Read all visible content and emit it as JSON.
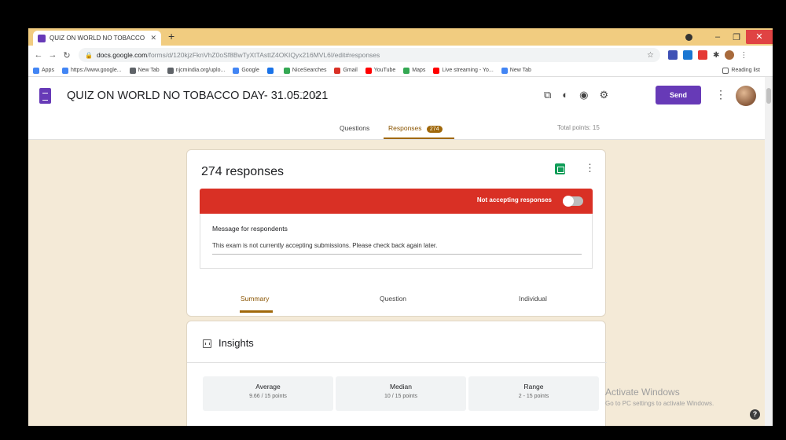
{
  "browser": {
    "tab_title": "QUIZ ON WORLD NO TOBACCO",
    "new_tab_symbol": "+",
    "url_host": "docs.google.com",
    "url_path": "/forms/d/120kjzFknVhZ0oSf8BwTyXtTAsttZ4OKIQyx216MVL6I/edit#responses"
  },
  "bookmarks": [
    {
      "label": "Apps",
      "color": "#4285f4"
    },
    {
      "label": "https://www.google...",
      "color": "#4285f4"
    },
    {
      "label": "New Tab",
      "color": "#5f6368"
    },
    {
      "label": "njcmindia.org/uplo...",
      "color": "#5f6368"
    },
    {
      "label": "Google",
      "color": "#4285f4"
    },
    {
      "label": "",
      "color": "#1a73e8"
    },
    {
      "label": "NiceSearches",
      "color": "#34a853"
    },
    {
      "label": "Gmail",
      "color": "#d93025"
    },
    {
      "label": "YouTube",
      "color": "#ff0000"
    },
    {
      "label": "Maps",
      "color": "#34a853"
    },
    {
      "label": "Live streaming - Yo...",
      "color": "#ff0000"
    },
    {
      "label": "New Tab",
      "color": "#4285f4"
    }
  ],
  "reading_list": "Reading list",
  "form": {
    "title": "QUIZ ON WORLD NO TOBACCO DAY- 31.05.2021",
    "send_label": "Send"
  },
  "tabs": {
    "questions": "Questions",
    "responses": "Responses",
    "responses_count": "274",
    "total_points": "Total points: 15"
  },
  "responses_card": {
    "count_label": "274 responses",
    "accepting_label": "Not accepting responses",
    "message_label": "Message for respondents",
    "message_text": "This exam is not currently accepting submissions. Please check back again later.",
    "subtabs": [
      "Summary",
      "Question",
      "Individual"
    ]
  },
  "insights": {
    "title": "Insights",
    "stats": [
      {
        "name": "Average",
        "value": "9.66 / 15 points"
      },
      {
        "name": "Median",
        "value": "10 / 15 points"
      },
      {
        "name": "Range",
        "value": "2 - 15 points"
      }
    ]
  },
  "watermark": {
    "line1": "Activate Windows",
    "line2": "Go to PC settings to activate Windows."
  },
  "colors": {
    "brand": "#673ab7",
    "accent": "#a0680a",
    "alert": "#d93025",
    "page_bg": "#f4ead7"
  }
}
